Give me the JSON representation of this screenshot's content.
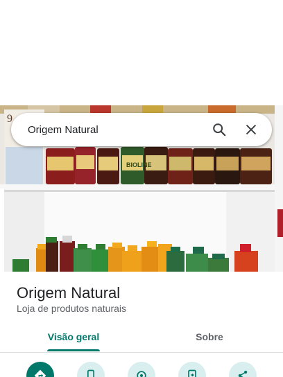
{
  "search": {
    "query": "Origem Natural",
    "search_icon": "search-icon",
    "close_icon": "close-icon"
  },
  "hero": {
    "label_text": "BIOLINE"
  },
  "place": {
    "name": "Origem Natural",
    "category": "Loja de produtos naturais"
  },
  "tabs": [
    {
      "label": "Visão geral",
      "selected": true
    },
    {
      "label": "Sobre",
      "selected": false
    }
  ],
  "actions": [
    {
      "icon": "directions-icon"
    },
    {
      "icon": "phone-icon"
    },
    {
      "icon": "save-location-icon"
    },
    {
      "icon": "send-to-phone-icon"
    },
    {
      "icon": "share-icon"
    }
  ],
  "colors": {
    "accent": "#00796b",
    "action_bg": "#d9eeef",
    "title": "#202124",
    "subtitle": "#5f6368",
    "divider": "#dadce0"
  }
}
